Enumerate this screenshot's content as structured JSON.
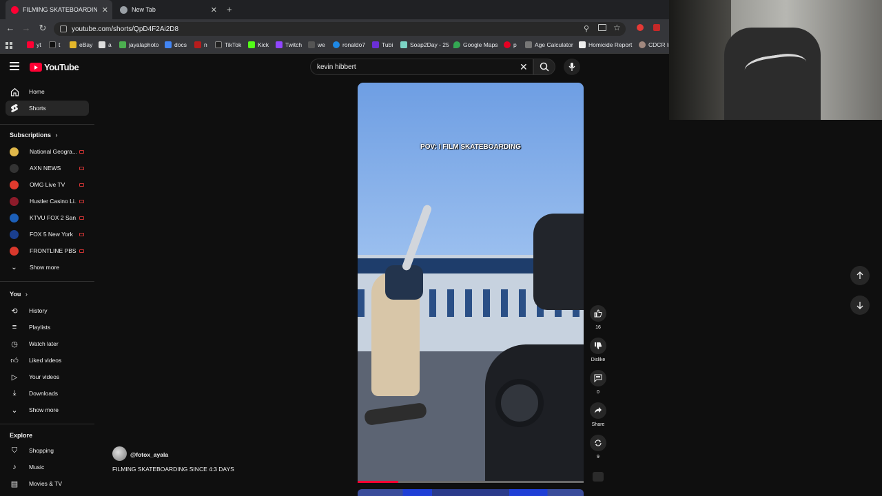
{
  "browser": {
    "tabs": [
      {
        "title": "FILMING SKATEBOARDING SIN"
      },
      {
        "title": "New Tab"
      }
    ],
    "url": "youtube.com/shorts/QpD4F2Ai2D8",
    "new_tab_glyph": "+",
    "bookmarks": [
      "yt",
      "t",
      "eBay",
      "a",
      "jayalaphoto",
      "docs",
      "n",
      "TikTok",
      "Kick",
      "Twitch",
      "we",
      "ronaldo7",
      "Tubi",
      "Soap2Day - 25",
      "Google Maps",
      "p",
      "Age Calculator",
      "Homicide Report",
      "CDCR In"
    ]
  },
  "header": {
    "logo": "YouTube",
    "search_value": "kevin hibbert",
    "clear_glyph": "✕"
  },
  "sidebar": {
    "main": [
      {
        "label": "Home",
        "icon": "home-icon"
      },
      {
        "label": "Shorts",
        "icon": "shorts-icon"
      }
    ],
    "subscriptions_title": "Subscriptions",
    "subscriptions": [
      {
        "label": "National Geogra...",
        "color": "#e0b84a"
      },
      {
        "label": "AXN NEWS",
        "color": "#333333"
      },
      {
        "label": "OMG Live TV",
        "color": "#e33b2e"
      },
      {
        "label": "Hustler Casino Li...",
        "color": "#8c1b2a"
      },
      {
        "label": "KTVU FOX 2 San...",
        "color": "#1c5fb8"
      },
      {
        "label": "FOX 5 New York",
        "color": "#1a3f8f"
      },
      {
        "label": "FRONTLINE PBS ...",
        "color": "#d9382c"
      }
    ],
    "show_more": "Show more",
    "you_title": "You",
    "you": [
      {
        "label": "History",
        "icon": "history-icon"
      },
      {
        "label": "Playlists",
        "icon": "playlists-icon"
      },
      {
        "label": "Watch later",
        "icon": "watch-later-icon"
      },
      {
        "label": "Liked videos",
        "icon": "liked-videos-icon"
      },
      {
        "label": "Your videos",
        "icon": "your-videos-icon"
      },
      {
        "label": "Downloads",
        "icon": "downloads-icon"
      },
      {
        "label": "Show more",
        "icon": "chevron-down-icon"
      }
    ],
    "explore_title": "Explore",
    "explore": [
      {
        "label": "Shopping",
        "icon": "shopping-icon"
      },
      {
        "label": "Music",
        "icon": "music-icon"
      },
      {
        "label": "Movies & TV",
        "icon": "movies-icon"
      }
    ]
  },
  "short": {
    "caption": "POV: I FILM SKATEBOARDING",
    "channel": "@fotox_ayala",
    "title": "FILMING SKATEBOARDING SINCE 4:3 DAYS",
    "likes": "16",
    "dislike_label": "Dislike",
    "comments": "0",
    "share_label": "Share",
    "remix_count": "9",
    "progress": 0.18
  },
  "colors": {
    "accent": "#ff0033",
    "background": "#0f0f0f"
  }
}
